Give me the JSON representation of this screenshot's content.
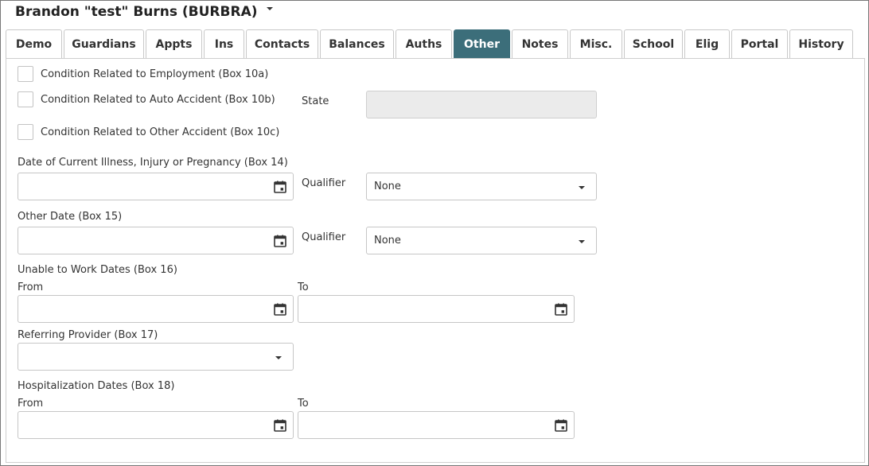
{
  "header": {
    "patient_name": "Brandon \"test\" Burns (BURBRA)"
  },
  "tabs": [
    {
      "label": "Demo"
    },
    {
      "label": "Guardians"
    },
    {
      "label": "Appts"
    },
    {
      "label": "Ins"
    },
    {
      "label": "Contacts"
    },
    {
      "label": "Balances"
    },
    {
      "label": "Auths"
    },
    {
      "label": "Other"
    },
    {
      "label": "Notes"
    },
    {
      "label": "Misc."
    },
    {
      "label": "School"
    },
    {
      "label": "Elig"
    },
    {
      "label": "Portal"
    },
    {
      "label": "History"
    }
  ],
  "active_tab": "Other",
  "colors": {
    "active_tab_bg": "#3c6e7a",
    "disabled_field_bg": "#ebebeb"
  },
  "form": {
    "cond_employment_label": "Condition Related to Employment (Box 10a)",
    "cond_auto_label": "Condition Related to Auto Accident (Box 10b)",
    "state_label": "State",
    "cond_other_label": "Condition Related to Other Accident (Box 10c)",
    "illness_date_label": "Date of Current Illness, Injury or Pregnancy (Box 14)",
    "qualifier_label": "Qualifier",
    "illness_qualifier_value": "None",
    "other_date_label": "Other Date (Box 15)",
    "other_qualifier_value": "None",
    "unable_work_label": "Unable to Work Dates (Box 16)",
    "from_label": "From",
    "to_label": "To",
    "referring_provider_label": "Referring Provider (Box 17)",
    "hospitalization_label": "Hospitalization Dates (Box 18)"
  }
}
